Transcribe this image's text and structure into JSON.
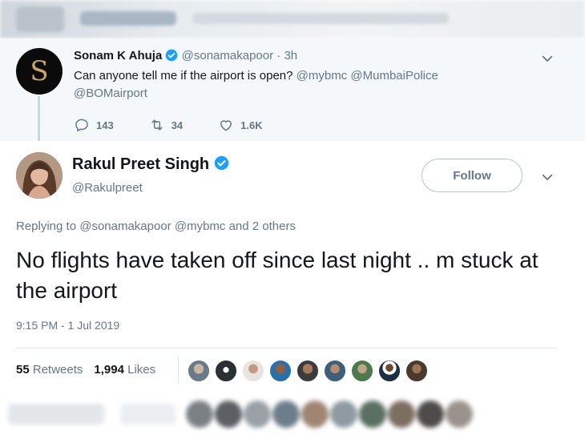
{
  "parent_tweet": {
    "name": "Sonam K Ahuja",
    "handle": "@sonamakapoor",
    "time": "· 3h",
    "avatar_letter": "S",
    "text_plain": "Can anyone tell me if the airport is open?",
    "mentions": [
      "@mybmc",
      "@MumbaiPolice",
      "@BOMairport"
    ],
    "reply_count": "143",
    "retweet_count": "34",
    "like_count": "1.6K"
  },
  "tweet": {
    "name": "Rakul Preet Singh",
    "handle": "@Rakulpreet",
    "follow_label": "Follow",
    "replying_prefix": "Replying to",
    "replying_to": "@sonamakapoor @mybmc",
    "replying_suffix": "and 2 others",
    "text": "No flights have taken off since last night .. m stuck at the airport",
    "timestamp": "9:15 PM - 1 Jul 2019",
    "retweets_count": "55",
    "retweets_label": "Retweets",
    "likes_count": "1,994",
    "likes_label": "Likes"
  },
  "colors": {
    "verified": "#1da1f2",
    "muted": "#657786",
    "text": "#14171a",
    "parent_bg": "#f5f8fa",
    "border": "#e1e8ed"
  },
  "icons": [
    "verified-badge-icon",
    "chevron-down-icon",
    "reply-icon",
    "retweet-icon",
    "heart-icon"
  ]
}
